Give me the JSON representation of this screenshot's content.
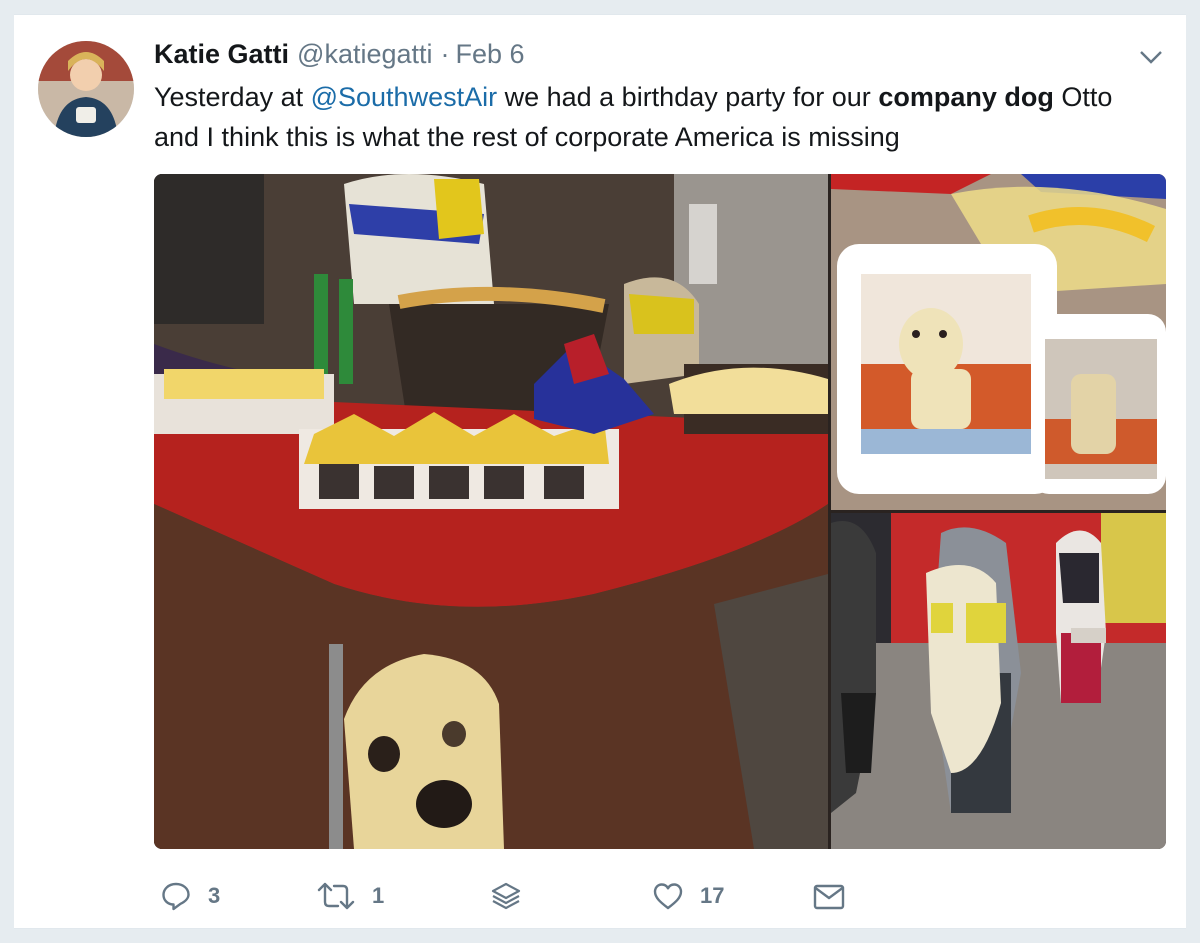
{
  "tweet": {
    "display_name": "Katie Gatti",
    "handle": "@katiegatti",
    "separator": "·",
    "timestamp": "Feb 6",
    "text": {
      "part1": "Yesterday at ",
      "mention": "@SouthwestAir",
      "part2": " we had a birthday party for our ",
      "bold": "company dog",
      "part3": " Otto and I think this is what the rest of corporate America is missing"
    },
    "avatar_icon": "user-avatar",
    "caret_icon": "chevron-down-icon"
  },
  "media": {
    "photos": [
      {
        "subject": "party-table-photo"
      },
      {
        "subject": "dog-cookies-photo"
      },
      {
        "subject": "dog-held-photo"
      }
    ]
  },
  "actions": {
    "reply": {
      "icon": "reply-icon",
      "count": "3"
    },
    "retweet": {
      "icon": "retweet-icon",
      "count": "1"
    },
    "stack": {
      "icon": "stack-icon"
    },
    "like": {
      "icon": "heart-icon",
      "count": "17"
    },
    "message": {
      "icon": "envelope-icon"
    }
  },
  "colors": {
    "background": "#e6ecf0",
    "card": "#ffffff",
    "text": "#14171a",
    "secondary": "#657786",
    "mention": "#1b6ca8"
  }
}
